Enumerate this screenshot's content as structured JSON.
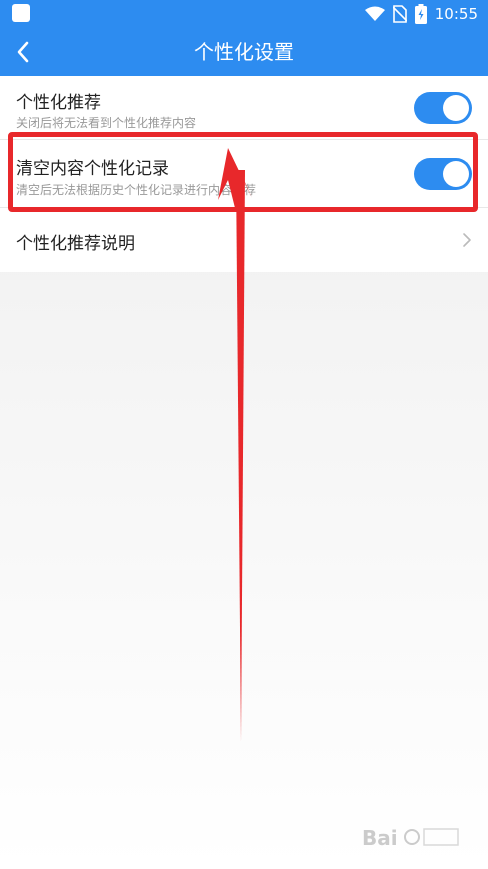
{
  "status_bar": {
    "time": "10:55",
    "icons": [
      "app-icon",
      "wifi-icon",
      "no-sim-icon",
      "battery-icon"
    ]
  },
  "header": {
    "title": "个性化设置",
    "back_icon": "chevron-left-icon"
  },
  "settings": {
    "items": [
      {
        "title": "个性化推荐",
        "subtitle": "关闭后将无法看到个性化推荐内容",
        "toggle_on": true
      },
      {
        "title": "清空内容个性化记录",
        "subtitle": "清空后无法根据历史个性化记录进行内容推荐",
        "toggle_on": true
      },
      {
        "title": "个性化推荐说明",
        "chevron": "chevron-right-icon"
      }
    ]
  },
  "annotation": {
    "highlight_color": "#e8282b"
  },
  "colors": {
    "accent": "#2d8cf0",
    "background": "#f2f2f2"
  }
}
